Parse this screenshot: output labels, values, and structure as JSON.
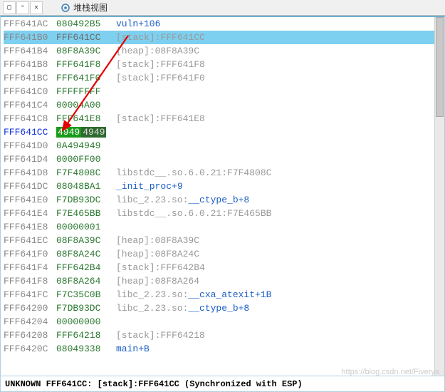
{
  "toolbar": {
    "title": "堆栈视图"
  },
  "rows": [
    {
      "addr": "FFF641AC",
      "addrCls": "",
      "val": "080492B5",
      "valCls": "",
      "note": {
        "pre": "",
        "link": "vuln+106",
        "post": ""
      },
      "sel": false
    },
    {
      "addr": "FFF641B0",
      "addrCls": "",
      "val": "FFF641CC",
      "valCls": "sel",
      "note": {
        "pre": "[stack]:FFF641CC",
        "link": "",
        "post": ""
      },
      "sel": true
    },
    {
      "addr": "FFF641B4",
      "addrCls": "",
      "val": "08F8A39C",
      "valCls": "",
      "note": {
        "pre": "[heap]:08F8A39C",
        "link": "",
        "post": ""
      },
      "sel": false
    },
    {
      "addr": "FFF641B8",
      "addrCls": "",
      "val": "FFF641F8",
      "valCls": "",
      "note": {
        "pre": "[stack]:FFF641F8",
        "link": "",
        "post": ""
      },
      "sel": false
    },
    {
      "addr": "FFF641BC",
      "addrCls": "",
      "val": "FFF641F0",
      "valCls": "",
      "note": {
        "pre": "[stack]:FFF641F0",
        "link": "",
        "post": ""
      },
      "sel": false
    },
    {
      "addr": "FFF641C0",
      "addrCls": "",
      "val": "FFFFFFFF",
      "valCls": "",
      "note": null,
      "sel": false
    },
    {
      "addr": "FFF641C4",
      "addrCls": "",
      "val": "00004A00",
      "valCls": "",
      "note": null,
      "sel": false
    },
    {
      "addr": "FFF641C8",
      "addrCls": "",
      "val": "FFF641E8",
      "valCls": "",
      "note": {
        "pre": "[stack]:FFF641E8",
        "link": "",
        "post": ""
      },
      "sel": false
    },
    {
      "addr": "FFF641CC",
      "addrCls": "blue",
      "val": "49494949",
      "valCls": "",
      "note": null,
      "sel": false,
      "highlight": true
    },
    {
      "addr": "FFF641D0",
      "addrCls": "",
      "val": "0A494949",
      "valCls": "",
      "note": null,
      "sel": false
    },
    {
      "addr": "FFF641D4",
      "addrCls": "",
      "val": "0000FF00",
      "valCls": "",
      "note": null,
      "sel": false
    },
    {
      "addr": "FFF641D8",
      "addrCls": "",
      "val": "F7F4808C",
      "valCls": "",
      "note": {
        "pre": "libstdc__.so.6.0.21:F7F4808C",
        "link": "",
        "post": ""
      },
      "sel": false
    },
    {
      "addr": "FFF641DC",
      "addrCls": "",
      "val": "08048BA1",
      "valCls": "",
      "note": {
        "pre": "",
        "link": "_init_proc+9",
        "post": ""
      },
      "sel": false
    },
    {
      "addr": "FFF641E0",
      "addrCls": "",
      "val": "F7DB93DC",
      "valCls": "",
      "note": {
        "pre": "libc_2.23.so:",
        "link": "__ctype_b+8",
        "post": ""
      },
      "sel": false
    },
    {
      "addr": "FFF641E4",
      "addrCls": "",
      "val": "F7E465BB",
      "valCls": "",
      "note": {
        "pre": "libstdc__.so.6.0.21:F7E465BB",
        "link": "",
        "post": ""
      },
      "sel": false
    },
    {
      "addr": "FFF641E8",
      "addrCls": "",
      "val": "00000001",
      "valCls": "",
      "note": null,
      "sel": false
    },
    {
      "addr": "FFF641EC",
      "addrCls": "",
      "val": "08F8A39C",
      "valCls": "",
      "note": {
        "pre": "[heap]:08F8A39C",
        "link": "",
        "post": ""
      },
      "sel": false
    },
    {
      "addr": "FFF641F0",
      "addrCls": "",
      "val": "08F8A24C",
      "valCls": "",
      "note": {
        "pre": "[heap]:08F8A24C",
        "link": "",
        "post": ""
      },
      "sel": false
    },
    {
      "addr": "FFF641F4",
      "addrCls": "",
      "val": "FFF642B4",
      "valCls": "",
      "note": {
        "pre": "[stack]:FFF642B4",
        "link": "",
        "post": ""
      },
      "sel": false
    },
    {
      "addr": "FFF641F8",
      "addrCls": "",
      "val": "08F8A264",
      "valCls": "",
      "note": {
        "pre": "[heap]:08F8A264",
        "link": "",
        "post": ""
      },
      "sel": false
    },
    {
      "addr": "FFF641FC",
      "addrCls": "",
      "val": "F7C35C0B",
      "valCls": "",
      "note": {
        "pre": "libc_2.23.so:",
        "link": "__cxa_atexit+1B",
        "post": ""
      },
      "sel": false
    },
    {
      "addr": "FFF64200",
      "addrCls": "",
      "val": "F7DB93DC",
      "valCls": "",
      "note": {
        "pre": "libc_2.23.so:",
        "link": "__ctype_b+8",
        "post": ""
      },
      "sel": false
    },
    {
      "addr": "FFF64204",
      "addrCls": "",
      "val": "00000000",
      "valCls": "",
      "note": null,
      "sel": false
    },
    {
      "addr": "FFF64208",
      "addrCls": "",
      "val": "FFF64218",
      "valCls": "",
      "note": {
        "pre": "[stack]:FFF64218",
        "link": "",
        "post": ""
      },
      "sel": false
    },
    {
      "addr": "FFF6420C",
      "addrCls": "",
      "val": "08049338",
      "valCls": "",
      "note": {
        "pre": "",
        "link": "main+B",
        "post": ""
      },
      "sel": false
    }
  ],
  "status": {
    "text": "UNKNOWN FFF641CC: [stack]:FFF641CC (Synchronized with ESP)"
  },
  "watermark": "https://blog.csdn.net/Fiverya"
}
